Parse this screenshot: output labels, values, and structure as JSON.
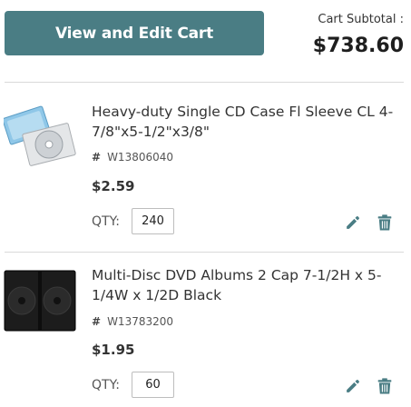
{
  "cart": {
    "view_edit_label": "View and Edit Cart",
    "subtotal_label": "Cart Subtotal :",
    "subtotal_value": "$738.60"
  },
  "items": [
    {
      "title": "Heavy-duty Single CD Case Fl Sleeve CL 4-7/8\"x5-1/2\"x3/8\"",
      "sku_prefix": "#",
      "sku": "W13806040",
      "price": "$2.59",
      "qty_label": "QTY:",
      "qty": "240"
    },
    {
      "title": "Multi-Disc DVD Albums 2 Cap 7-1/2H x 5-1/4W x 1/2D Black",
      "sku_prefix": "#",
      "sku": "W13783200",
      "price": "$1.95",
      "qty_label": "QTY:",
      "qty": "60"
    }
  ],
  "colors": {
    "button": "#4a7d84",
    "action_icons": "#4a7d84",
    "divider": "#d9d9d9"
  },
  "icons": [
    "pencil-icon",
    "trash-icon"
  ]
}
